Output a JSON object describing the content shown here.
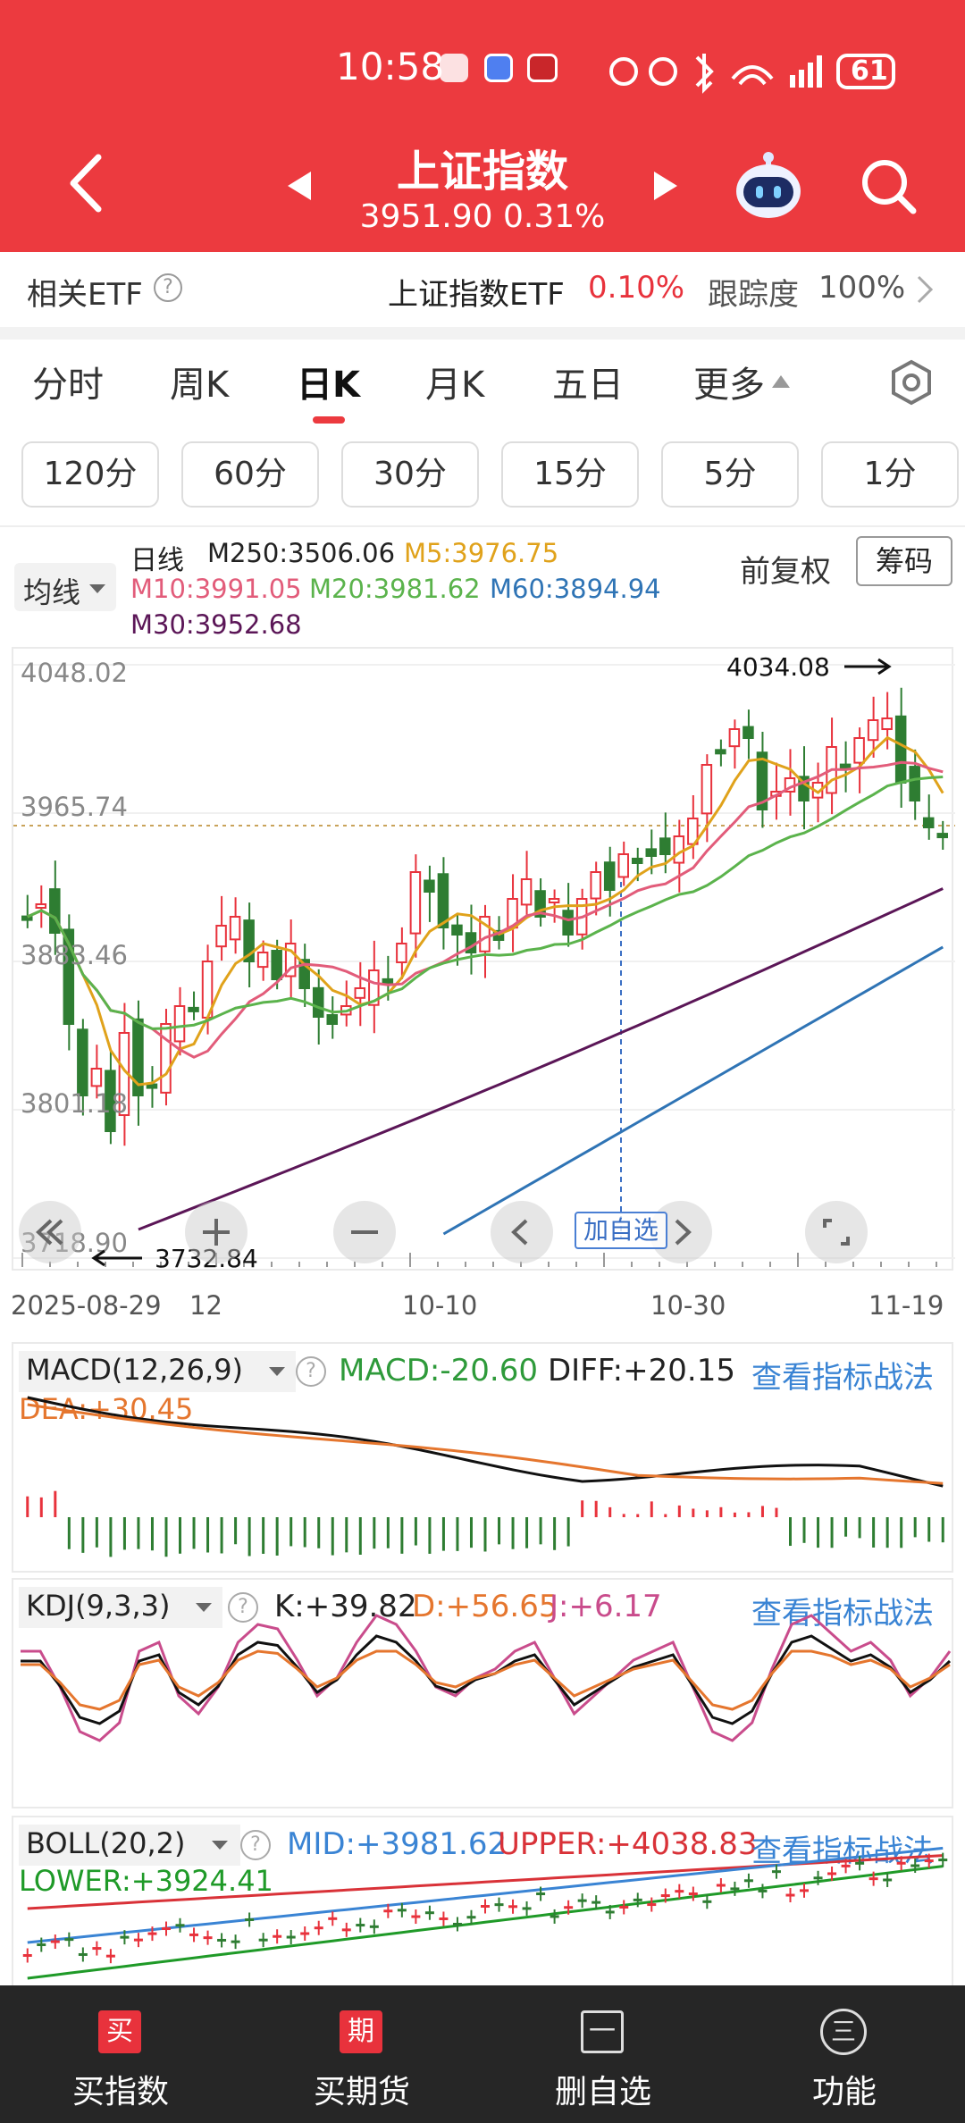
{
  "status": {
    "time": "10:58",
    "battery": "61"
  },
  "header": {
    "title": "上证指数",
    "price": "3951.90",
    "change": "0.31%"
  },
  "etf": {
    "label": "相关ETF",
    "name": "上证指数ETF",
    "change": "0.10%",
    "tracking_label": "跟踪度",
    "tracking": "100%"
  },
  "tabs": [
    "分时",
    "周K",
    "日K",
    "月K",
    "五日",
    "更多"
  ],
  "timeframes": [
    "120分",
    "60分",
    "30分",
    "15分",
    "5分",
    "1分"
  ],
  "ma": {
    "selector": "均线",
    "period": "日线",
    "m250": "M250:3506.06",
    "m5": "M5:3976.75",
    "m10": "M10:3991.05",
    "m20": "M20:3981.62",
    "m60": "M60:3894.94",
    "m30": "M30:3952.68",
    "adjust": "前复权",
    "chips": "筹码"
  },
  "main_chart": {
    "y_labels": [
      "4048.02",
      "3965.74",
      "3883.46",
      "3801.18",
      "3718.90"
    ],
    "high_label": "4034.08",
    "low_label": "3732.84",
    "dates": [
      "2025-08-29",
      "12",
      "10-10",
      "10-30",
      "11-19"
    ],
    "watch_badge": "加自选"
  },
  "macd": {
    "name": "MACD(12,26,9)",
    "macd": "MACD:-20.60",
    "diff": "DIFF:+20.15",
    "dea": "DEA:+30.45",
    "link": "查看指标战法"
  },
  "kdj": {
    "name": "KDJ(9,3,3)",
    "k": "K:+39.82",
    "d": "D:+56.65",
    "j": "J:+6.17",
    "link": "查看指标战法"
  },
  "boll": {
    "name": "BOLL(20,2)",
    "mid": "MID:+3981.62",
    "upper": "UPPER:+4038.83",
    "lower": "LOWER:+3924.41",
    "link": "查看指标战法"
  },
  "bottom_nav": [
    {
      "icon": "买",
      "label": "买指数"
    },
    {
      "icon": "期",
      "label": "买期货"
    },
    {
      "icon": "一",
      "label": "删自选"
    },
    {
      "icon": "三",
      "label": "功能"
    }
  ],
  "colors": {
    "up": "#e8323c",
    "down": "#2e7d32",
    "brand": "#ec3a3f"
  }
}
